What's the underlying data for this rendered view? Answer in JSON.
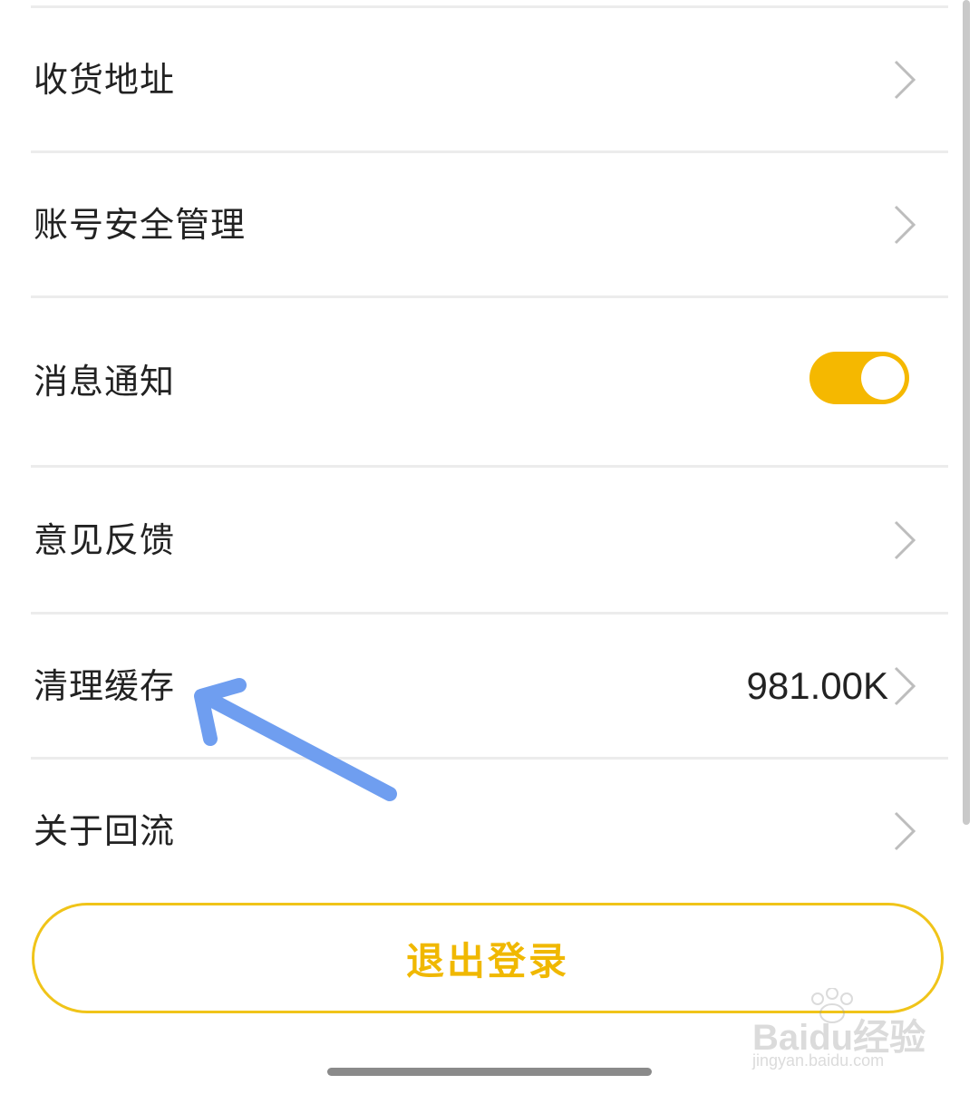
{
  "settings": {
    "items": [
      {
        "label": "收货地址",
        "type": "link"
      },
      {
        "label": "账号安全管理",
        "type": "link"
      },
      {
        "label": "消息通知",
        "type": "toggle",
        "enabled": true
      },
      {
        "label": "意见反馈",
        "type": "link"
      },
      {
        "label": "清理缓存",
        "type": "link",
        "value": "981.00K"
      },
      {
        "label": "关于回流",
        "type": "link"
      }
    ],
    "logout_label": "退出登录"
  },
  "colors": {
    "accent": "#f5b800",
    "logout_text": "#f0b800",
    "annotation_arrow": "#6f9ef0"
  },
  "watermark": {
    "brand": "Baidu经验",
    "url": "jingyan.baidu.com"
  }
}
